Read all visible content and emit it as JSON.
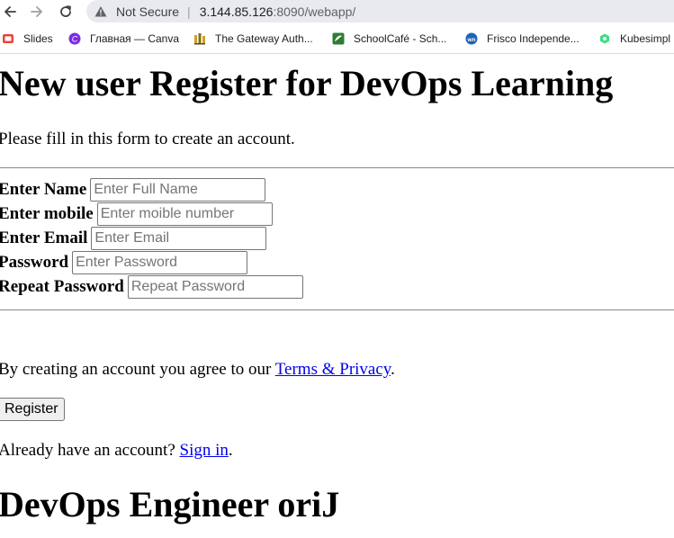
{
  "browser": {
    "security_label": "Not Secure",
    "url_host": "3.144.85.126",
    "url_rest": ":8090/webapp/",
    "bookmarks": [
      {
        "label": "Slides",
        "icon": "slides-icon",
        "color": "#e8453c"
      },
      {
        "label": "Главная — Canva",
        "icon": "canva-icon",
        "color": "#7d2ae8"
      },
      {
        "label": "The Gateway Auth...",
        "icon": "gateway-icon",
        "color": "#c9a227"
      },
      {
        "label": "SchoolCafé - Sch...",
        "icon": "schoolcafe-icon",
        "color": "#2e7d32"
      },
      {
        "label": "Frisco Independe...",
        "icon": "frisco-icon",
        "color": "#1e63b8"
      },
      {
        "label": "Kubesimpl",
        "icon": "kubesimpl-icon",
        "color": "#3ddc84"
      }
    ]
  },
  "page": {
    "title": "New user Register for DevOps Learning",
    "intro": "Please fill in this form to create an account.",
    "fields": [
      {
        "label": "Enter Name",
        "placeholder": "Enter Full Name",
        "value": ""
      },
      {
        "label": "Enter mobile",
        "placeholder": "Enter moible number",
        "value": ""
      },
      {
        "label": "Enter Email",
        "placeholder": "Enter Email",
        "value": ""
      },
      {
        "label": "Password",
        "placeholder": "Enter Password",
        "value": ""
      },
      {
        "label": "Repeat Password",
        "placeholder": "Repeat Password",
        "value": ""
      }
    ],
    "agree_prefix": "By creating an account you agree to our ",
    "agree_link": "Terms & Privacy",
    "agree_suffix": ".",
    "register_label": "Register",
    "signin_prefix": "Already have an account? ",
    "signin_link": "Sign in",
    "signin_suffix": ".",
    "footer_title": "DevOps Engineer oriJ"
  },
  "colors": {
    "link": "#0000ee",
    "address_bar_bg": "#e8eaed"
  }
}
